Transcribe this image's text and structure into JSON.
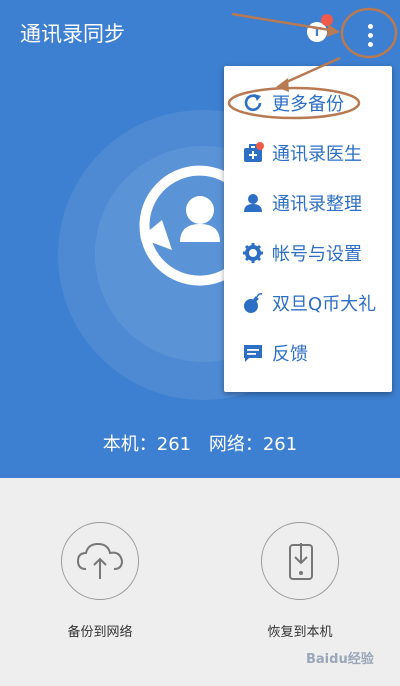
{
  "header": {
    "title": "通讯录同步",
    "t_icon": "T"
  },
  "counts": {
    "local": "本机：261",
    "network": "网络：261"
  },
  "menu": {
    "items": [
      {
        "label": "更多备份",
        "icon": "sync-icon"
      },
      {
        "label": "通讯录医生",
        "icon": "doctor-kit-icon"
      },
      {
        "label": "通讯录整理",
        "icon": "person-icon"
      },
      {
        "label": "帐号与设置",
        "icon": "gear-icon"
      },
      {
        "label": "双旦Q币大礼",
        "icon": "bomb-icon"
      },
      {
        "label": "反馈",
        "icon": "chat-icon"
      }
    ]
  },
  "actions": {
    "backup_label": "备份到网络",
    "restore_label": "恢复到本机"
  },
  "watermark": "Baidu经验",
  "colors": {
    "primary": "#3d7fd0",
    "menu_text": "#2d6fc4",
    "badge": "#f05a4b",
    "annotation": "#b87a52"
  }
}
